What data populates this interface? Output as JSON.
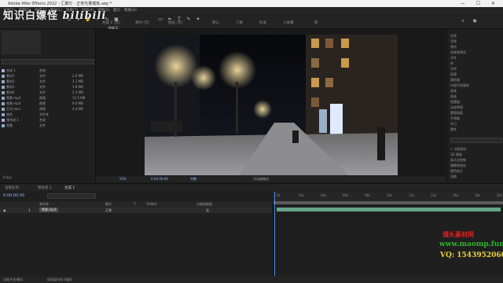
{
  "window": {
    "title": "Adobe After Effects 2022 - 汇聚灯 - 正常光量模板.aep *",
    "controls": "— ☐ ✕"
  },
  "menu": [
    "文件(F)",
    "编辑(E)",
    "合成(C)",
    "图层(L)",
    "效果(T)",
    "动画(A)",
    "视图(V)",
    "窗口",
    "帮助(H)"
  ],
  "overlay_logo": {
    "cn": "知识白嫖怪",
    "bili": "bilibili"
  },
  "toolbar_tabs": [
    "合成 1 (无)",
    "素材 (无)",
    "图层 (无)",
    "默认",
    "了解",
    "标准",
    "小屏幕",
    "库"
  ],
  "comp_tab": "合成 1",
  "project": {
    "search_placeholder": "",
    "rows": [
      {
        "name": "合成 1",
        "type": "合成",
        "size": "",
        "comp": true
      },
      {
        "name": "素材1",
        "type": "文件",
        "size": "2.0 MB",
        "comp": false
      },
      {
        "name": "素材2",
        "type": "文件",
        "size": "2.1 MB",
        "comp": false
      },
      {
        "name": "素材3",
        "type": "文件",
        "size": "1.8 MB",
        "comp": false
      },
      {
        "name": "素材4",
        "type": "文件",
        "size": "2.3 MB",
        "comp": false
      },
      {
        "name": "雪景.mp4",
        "type": "视频",
        "size": "12.5 MB",
        "comp": false
      },
      {
        "name": "夜景.mp4",
        "type": "视频",
        "size": "9.6 MB",
        "comp": false
      },
      {
        "name": "灯光.mov",
        "type": "视频",
        "size": "4.4 MB",
        "comp": false
      },
      {
        "name": "纯色",
        "type": "文件夹",
        "size": "",
        "comp": false
      },
      {
        "name": "预合成 1",
        "type": "合成",
        "size": "",
        "comp": true
      },
      {
        "name": "背景",
        "type": "文件",
        "size": "",
        "comp": false
      }
    ],
    "footer": "8 bpc"
  },
  "right_panel": {
    "items": [
      "信息",
      "音频",
      "预览",
      "效果和预设",
      "对齐",
      "库",
      "字符",
      "段落",
      "跟踪器",
      "内容识别填充",
      "画笔",
      "绘画",
      "摇摆器",
      "动态草图",
      "蒙版插值",
      "平滑器",
      "学习",
      "属性"
    ],
    "section_items": [
      "+ 动画预设",
      "3D 通道",
      "表达式控制",
      "模糊和锐化",
      "颜色校正",
      "扭曲"
    ]
  },
  "comp_footer": {
    "zoom": "50%",
    "time": "0:00:00:00",
    "quality": "完整",
    "camera": "活动摄像机"
  },
  "timeline": {
    "tabs": [
      "渲染队列",
      "预合成 1",
      "合成 1"
    ],
    "timecode": "0:00:00:00",
    "columns": [
      "源名称",
      "模式",
      "T",
      "TrkMat",
      "父级和链接"
    ],
    "layer": {
      "number": "1",
      "name": "雪景.mp4",
      "mode": "正常",
      "parent": "无"
    },
    "ruler_marks": [
      "0s",
      "02s",
      "04s",
      "06s",
      "08s",
      "10s",
      "12s",
      "14s",
      "16s",
      "18s",
      "20s"
    ]
  },
  "status_bar": [
    "切换开关/模式",
    "帧渲染时间 0毫秒"
  ],
  "site_watermark": {
    "brand": "馒头素材网",
    "url": "www.maomp.fun",
    "contact": "VQ: 1543952060"
  }
}
